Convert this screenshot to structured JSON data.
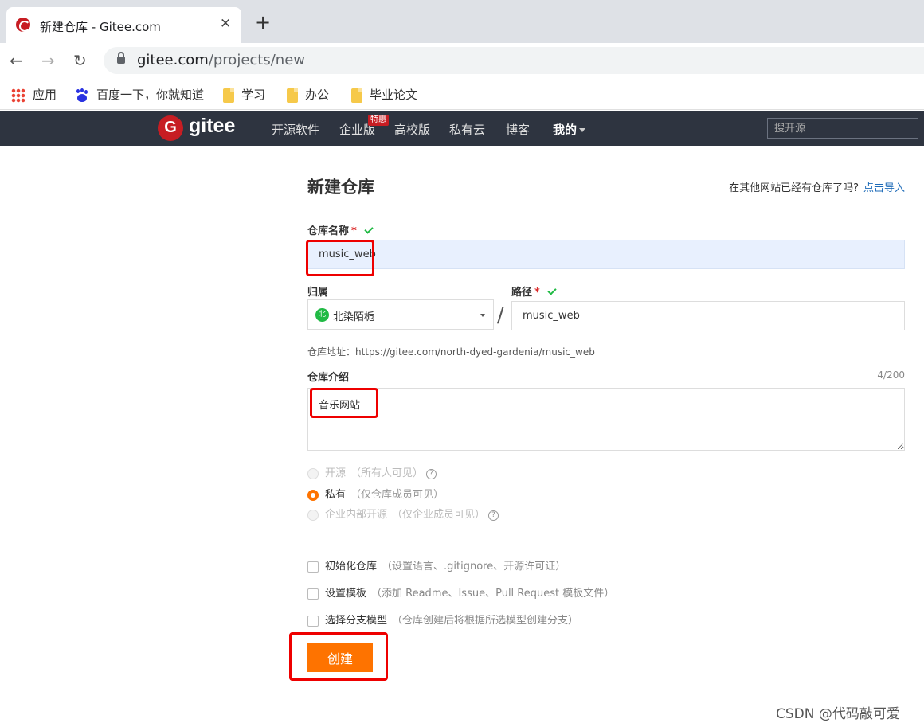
{
  "browser": {
    "tab_title": "新建仓库 - Gitee.com",
    "close_glyph": "✕",
    "newtab_glyph": "+",
    "back_glyph": "←",
    "forward_glyph": "→",
    "reload_glyph": "↻",
    "url_host": "gitee.com",
    "url_path": "/projects/new"
  },
  "bookmarks": [
    {
      "label": "应用",
      "icon": "apps-icon"
    },
    {
      "label": "百度一下，你就知道",
      "icon": "baidu-paw-icon"
    },
    {
      "label": "学习",
      "icon": "folder-icon"
    },
    {
      "label": "办公",
      "icon": "folder-icon"
    },
    {
      "label": "毕业论文",
      "icon": "folder-icon"
    }
  ],
  "navbar": {
    "brand": "gitee",
    "items": [
      "开源软件",
      "企业版",
      "高校版",
      "私有云",
      "博客",
      "我的"
    ],
    "badge": "特惠",
    "search_placeholder": "搜开源"
  },
  "form": {
    "title": "新建仓库",
    "import_hint": "在其他网站已经有仓库了吗?",
    "import_link": "点击导入",
    "name_label": "仓库名称",
    "required_mark": "*",
    "name_value": "music_web",
    "owner_label": "归属",
    "owner_avatar": "北",
    "owner_name": "北染陌栀",
    "slash": "/",
    "path_label": "路径",
    "path_value": "music_web",
    "address": "仓库地址：https://gitee.com/north-dyed-gardenia/music_web",
    "intro_label": "仓库介绍",
    "intro_counter": "4/200",
    "intro_value": "音乐网站",
    "visibility": [
      {
        "label": "开源",
        "note": "（所有人可见）",
        "help": "?",
        "selected": false,
        "disabled": true
      },
      {
        "label": "私有",
        "note": "（仅仓库成员可见）",
        "help": "",
        "selected": true,
        "disabled": false
      },
      {
        "label": "企业内部开源",
        "note": "（仅企业成员可见）",
        "help": "?",
        "selected": false,
        "disabled": true
      }
    ],
    "options": [
      {
        "label": "初始化仓库",
        "note": "（设置语言、.gitignore、开源许可证）"
      },
      {
        "label": "设置模板",
        "note": "（添加 Readme、Issue、Pull Request 模板文件）"
      },
      {
        "label": "选择分支模型",
        "note": "（仓库创建后将根据所选模型创建分支）"
      }
    ],
    "create_button": "创建"
  },
  "watermark": "CSDN @代码敲可爱",
  "colors": {
    "accent": "#fe7300",
    "nav_bg": "#2e3440",
    "brand_red": "#c71d23",
    "link": "#1e6bb8",
    "valid": "#21ba45",
    "highlight": "#ee0000"
  }
}
